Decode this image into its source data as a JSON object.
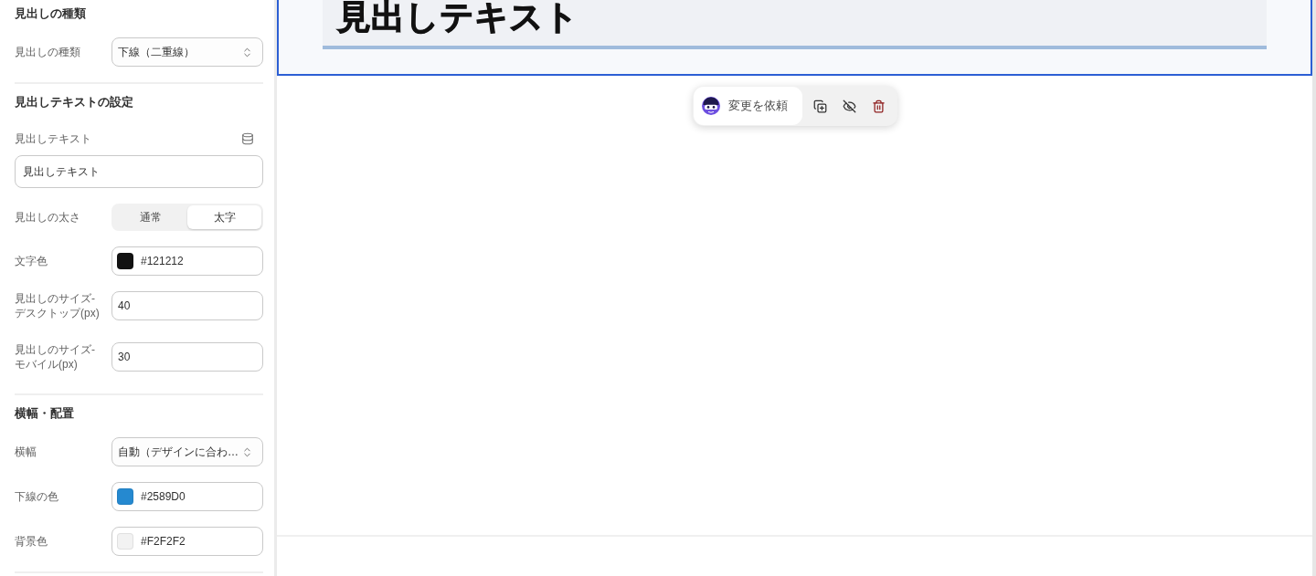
{
  "settings_panel": {
    "sections": [
      {
        "title": "見出しの種類",
        "fields": [
          {
            "kind": "select",
            "label": "見出しの種類",
            "value": "下線（二重線）"
          }
        ]
      },
      {
        "title": "見出しテキストの設定",
        "fields": [
          {
            "kind": "text",
            "label": "見出しテキスト",
            "value": "見出しテキスト"
          },
          {
            "kind": "segmented",
            "label": "見出しの太さ",
            "options": [
              {
                "label": "通常",
                "selected": false
              },
              {
                "label": "太字",
                "selected": true
              }
            ]
          },
          {
            "kind": "color",
            "label": "文字色",
            "value": "#121212",
            "color": "#121212"
          },
          {
            "kind": "number",
            "label": "見出しのサイズ-\nデスクトップ(px)",
            "value": "40"
          },
          {
            "kind": "number",
            "label": "見出しのサイズ-\nモバイル(px)",
            "value": "30"
          }
        ]
      },
      {
        "title": "横幅・配置",
        "fields": [
          {
            "kind": "select",
            "label": "横幅",
            "value": "自動（デザインに合わ…"
          },
          {
            "kind": "color",
            "label": "下線の色",
            "value": "#2589D0",
            "color": "#2589d0"
          },
          {
            "kind": "color",
            "label": "背景色",
            "value": "#F2F2F2",
            "color": "#f2f2f2"
          }
        ]
      }
    ]
  },
  "canvas": {
    "heading_block": {
      "text": "見出しテキスト",
      "selected": true
    },
    "toolbar": {
      "request_button": "変更を依頼"
    }
  }
}
